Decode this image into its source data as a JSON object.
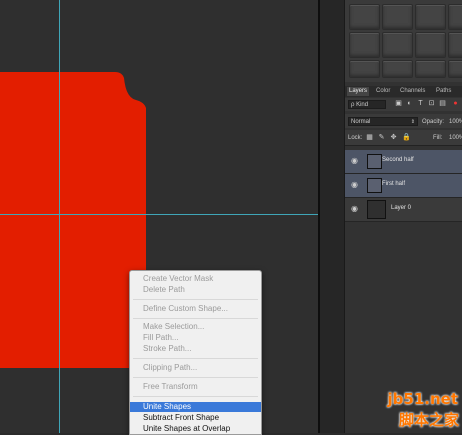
{
  "layers_panel": {
    "tabs": [
      "Layers",
      "Color",
      "Channels",
      "Paths"
    ],
    "active_tab": "Layers",
    "filter": {
      "label": "ρ Kind"
    },
    "blend_mode": "Normal",
    "opacity_label": "Opacity:",
    "opacity_value": "100%",
    "lock_label": "Lock:",
    "fill_label": "Fill:",
    "fill_value": "100%",
    "layers": [
      {
        "name": "Second half",
        "selected": true,
        "type": "shape"
      },
      {
        "name": "First half",
        "selected": true,
        "type": "shape"
      },
      {
        "name": "Layer 0",
        "selected": false,
        "type": "pixel"
      }
    ]
  },
  "canvas": {
    "shape_color": "#e31e00",
    "guide_color": "#3fa6b8"
  },
  "context_menu": {
    "items": [
      {
        "label": "Create Vector Mask",
        "enabled": false
      },
      {
        "label": "Delete Path",
        "enabled": false
      },
      {
        "label": "Define Custom Shape...",
        "enabled": false
      },
      {
        "label": "Make Selection...",
        "enabled": false
      },
      {
        "label": "Fill Path...",
        "enabled": false
      },
      {
        "label": "Stroke Path...",
        "enabled": false
      },
      {
        "label": "Clipping Path...",
        "enabled": false
      },
      {
        "label": "Free Transform",
        "enabled": false
      },
      {
        "label": "Unite Shapes",
        "enabled": true,
        "highlighted": true
      },
      {
        "label": "Subtract Front Shape",
        "enabled": true
      },
      {
        "label": "Unite Shapes at Overlap",
        "enabled": true
      }
    ]
  },
  "watermark": {
    "line1": "jb51.net",
    "line2": "脚本之家"
  }
}
